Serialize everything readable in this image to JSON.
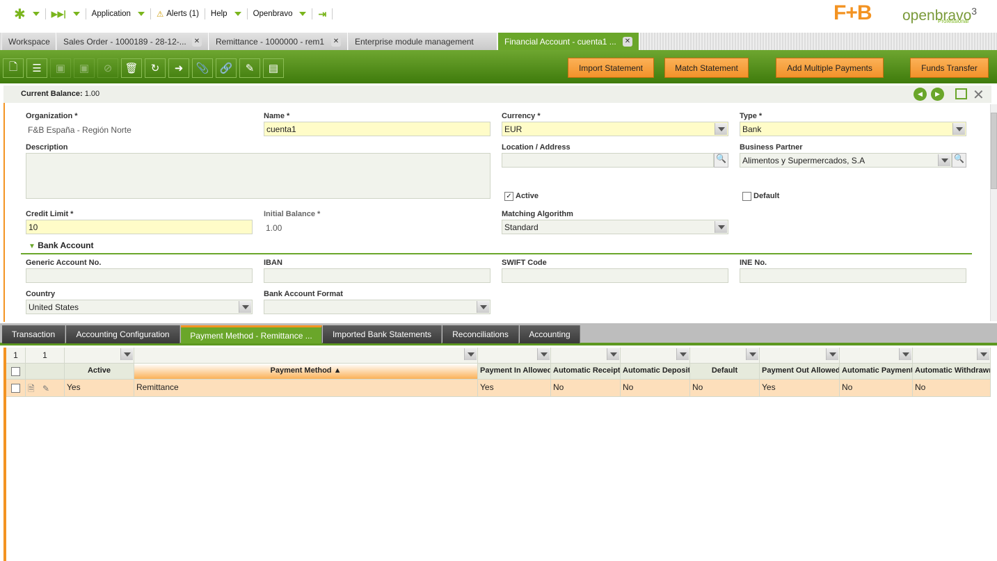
{
  "topbar": {
    "application": "Application",
    "alerts": "Alerts (1)",
    "help": "Help",
    "user": "Openbravo"
  },
  "logos": {
    "brand": "F+B",
    "openbravo": "openbravo",
    "edition": "Professional",
    "version": "3"
  },
  "window_tabs": [
    {
      "label": "Workspace",
      "closable": false
    },
    {
      "label": "Sales Order - 1000189 - 28-12-...",
      "closable": true
    },
    {
      "label": "Remittance - 1000000 - rem1",
      "closable": true
    },
    {
      "label": "Enterprise module management",
      "closable": false
    },
    {
      "label": "Financial Account - cuenta1 ...",
      "closable": true,
      "active": true
    }
  ],
  "toolbar": {
    "buttons": [
      "new-document",
      "new-row",
      "save",
      "save-close",
      "undo",
      "delete",
      "refresh",
      "export",
      "attach",
      "link",
      "tools",
      "grid-toggle"
    ],
    "actions": [
      "Import Statement",
      "Match Statement",
      "Add Multiple Payments",
      "Funds Transfer"
    ]
  },
  "balance": {
    "label": "Current Balance:",
    "value": "1.00"
  },
  "form": {
    "organization": {
      "label": "Organization *",
      "value": "F&B España - Región Norte"
    },
    "name": {
      "label": "Name *",
      "value": "cuenta1"
    },
    "currency": {
      "label": "Currency *",
      "value": "EUR"
    },
    "type": {
      "label": "Type *",
      "value": "Bank"
    },
    "description": {
      "label": "Description",
      "value": ""
    },
    "location": {
      "label": "Location / Address",
      "value": ""
    },
    "business_partner": {
      "label": "Business Partner",
      "value": "Alimentos y Supermercados, S.A"
    },
    "active": {
      "label": "Active",
      "checked": true
    },
    "default": {
      "label": "Default",
      "checked": false
    },
    "credit_limit": {
      "label": "Credit Limit *",
      "value": "10"
    },
    "initial_balance": {
      "label": "Initial Balance *",
      "value": "1.00"
    },
    "matching_algorithm": {
      "label": "Matching Algorithm",
      "value": "Standard"
    },
    "bank_section": "Bank Account",
    "generic_account": {
      "label": "Generic Account No.",
      "value": ""
    },
    "iban": {
      "label": "IBAN",
      "value": ""
    },
    "swift": {
      "label": "SWIFT Code",
      "value": ""
    },
    "ine": {
      "label": "INE No.",
      "value": ""
    },
    "country": {
      "label": "Country",
      "value": "United States"
    },
    "bank_format": {
      "label": "Bank Account Format",
      "value": ""
    }
  },
  "subtabs": [
    "Transaction",
    "Accounting Configuration",
    "Payment Method - Remittance ...",
    "Imported Bank Statements",
    "Reconciliations",
    "Accounting"
  ],
  "grid": {
    "count_selected": "1",
    "count_total": "1",
    "columns": [
      "Active",
      "Payment Method ▲",
      "Payment In Allowed",
      "Automatic Receipt",
      "Automatic Deposit",
      "Default",
      "Payment Out Allowed",
      "Automatic Payment",
      "Automatic Withdrawn"
    ],
    "rows": [
      [
        "Yes",
        "Remittance",
        "Yes",
        "No",
        "No",
        "No",
        "Yes",
        "No",
        "No"
      ]
    ]
  }
}
